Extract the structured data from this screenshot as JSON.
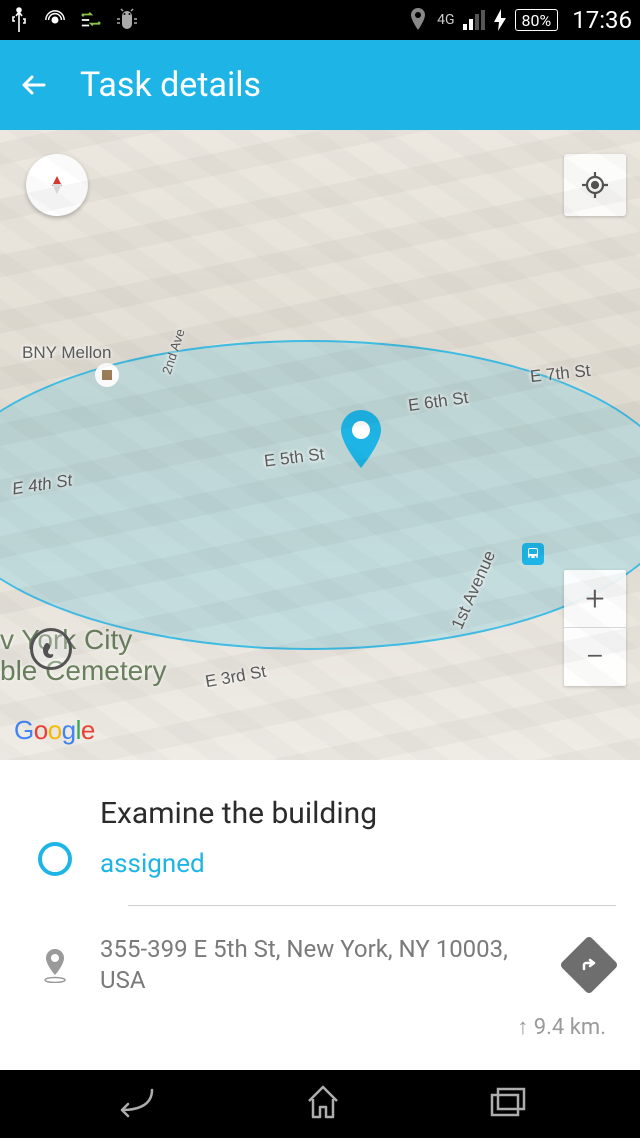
{
  "status_bar": {
    "network_type": "4G",
    "battery_percent": "80%",
    "time": "17:36"
  },
  "app_bar": {
    "title": "Task details"
  },
  "map": {
    "poi_bny": "BNY Mellon",
    "street_e3": "E 3rd St",
    "street_e4": "E 4th St",
    "street_e5": "E 5th St",
    "street_e6": "E 6th St",
    "street_e7": "E 7th St",
    "street_1ave": "1st Avenue",
    "street_2ave": "2nd Ave",
    "poi_line1": "v York City",
    "poi_line2": "ble Cemetery",
    "attribution": "Google",
    "zoom_in": "+",
    "zoom_out": "−"
  },
  "task": {
    "title": "Examine the building",
    "status": "assigned",
    "address": "355-399 E 5th St, New York, NY 10003, USA",
    "distance": "↑  9.4 km."
  }
}
